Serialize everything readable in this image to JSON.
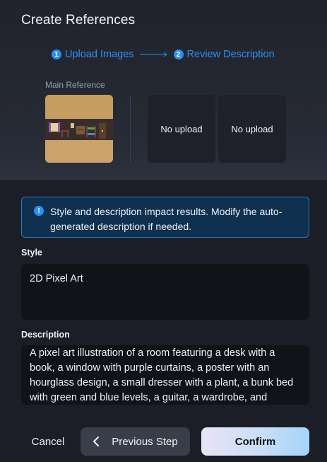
{
  "dialog": {
    "title": "Create References"
  },
  "stepper": {
    "steps": [
      {
        "number": "1",
        "label": "Upload Images"
      },
      {
        "number": "2",
        "label": "Review Description"
      }
    ],
    "accent_color": "#2f8ef0"
  },
  "references": {
    "main_label": "Main Reference",
    "slots": [
      {
        "label": "No upload"
      },
      {
        "label": "No upload"
      }
    ]
  },
  "notice": {
    "icon": "info-icon",
    "text": "Style and description impact results. Modify the auto-generated description if needed."
  },
  "style": {
    "label": "Style",
    "value": "2D Pixel Art"
  },
  "description": {
    "label": "Description",
    "value": "A pixel art illustration of a room featuring a desk with a book, a window with purple curtains, a poster with an hourglass design, a small dresser with a plant, a bunk bed with green and blue levels, a guitar, a wardrobe, and"
  },
  "footer": {
    "cancel_label": "Cancel",
    "previous_label": "Previous Step",
    "confirm_label": "Confirm"
  }
}
